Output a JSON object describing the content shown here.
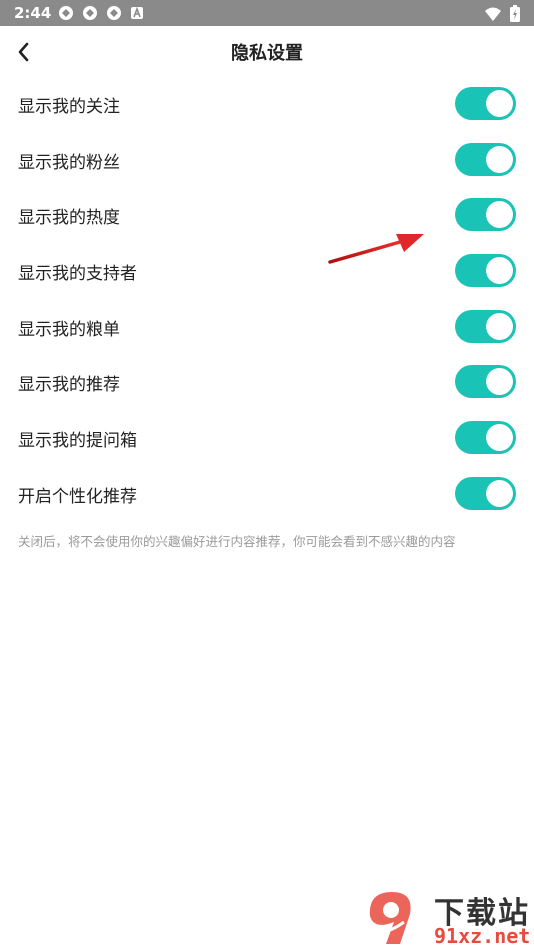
{
  "status_bar": {
    "time": "2:44",
    "notification_icons": [
      "app-icon",
      "app-icon",
      "app-icon",
      "a-icon"
    ],
    "right_icons": [
      "wifi-icon",
      "battery-icon"
    ]
  },
  "header": {
    "title": "隐私设置",
    "back_icon": "chevron-left-icon"
  },
  "settings": [
    {
      "label": "显示我的关注",
      "enabled": true
    },
    {
      "label": "显示我的粉丝",
      "enabled": true
    },
    {
      "label": "显示我的热度",
      "enabled": true
    },
    {
      "label": "显示我的支持者",
      "enabled": true
    },
    {
      "label": "显示我的粮单",
      "enabled": true
    },
    {
      "label": "显示我的推荐",
      "enabled": true
    },
    {
      "label": "显示我的提问箱",
      "enabled": true
    },
    {
      "label": "开启个性化推荐",
      "enabled": true
    }
  ],
  "hint": "关闭后，将不会使用你的兴趣偏好进行内容推荐，你可能会看到不感兴趣的内容",
  "colors": {
    "toggle_on": "#19c3b5",
    "status_bar": "#8a8a8a",
    "annotation_arrow": "#d42020"
  },
  "watermark": {
    "line1": "下载站",
    "line2": "91xz.net"
  }
}
